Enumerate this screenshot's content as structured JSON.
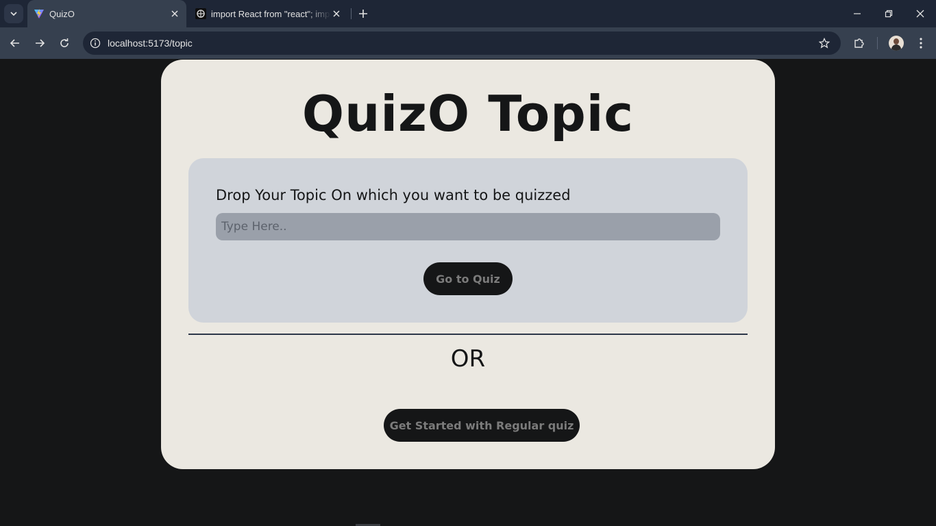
{
  "browser": {
    "tabs": [
      {
        "title": "QuizO",
        "favicon": "vite-logo-icon",
        "active": true
      },
      {
        "title": "import React from \"react\"; import",
        "favicon": "pattern-favicon-icon",
        "active": false
      }
    ],
    "url": "localhost:5173/topic"
  },
  "page": {
    "title": "QuizO Topic",
    "topic_label": "Drop Your Topic On which you want to be quizzed",
    "topic_input": {
      "value": "",
      "placeholder": "Type Here.."
    },
    "go_button": "Go to Quiz",
    "or_text": "OR",
    "regular_button": "Get Started with Regular quiz"
  },
  "colors": {
    "background": "#151617",
    "card": "#ebe8e1",
    "panel": "#d0d4da",
    "input": "#9aa0aa",
    "button": "#151617",
    "button_text": "#7b7b7b",
    "divider": "#2c3648"
  }
}
